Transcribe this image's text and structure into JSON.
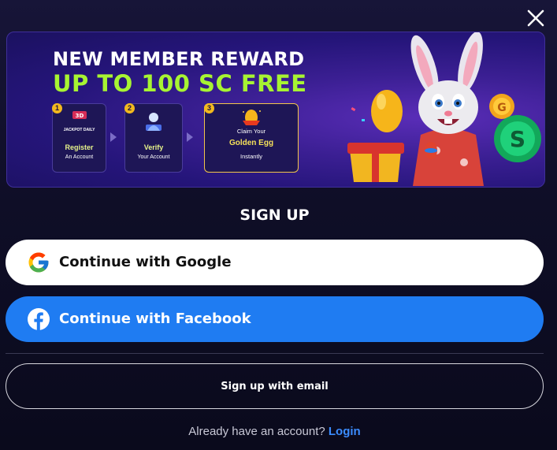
{
  "banner": {
    "title": "NEW MEMBER REWARD",
    "subtitle": "UP TO 100 SC FREE",
    "steps": [
      {
        "number": "1",
        "badge": "JACKPOT DAILY",
        "line1": "Register",
        "line2": "An Account"
      },
      {
        "number": "2",
        "line1": "Verify",
        "line2": "Your Account"
      },
      {
        "number": "3",
        "line0": "Claim Your",
        "line1": "Golden Egg",
        "line2": "Instantly"
      }
    ]
  },
  "signup": {
    "heading": "SIGN UP",
    "google_label": "Continue with Google",
    "facebook_label": "Continue with Facebook",
    "email_label": "Sign up with email"
  },
  "footer": {
    "prompt": "Already have an account?",
    "login_label": "Login"
  },
  "colors": {
    "accent_green": "#a7f432",
    "facebook_blue": "#1f7cf2",
    "login_link": "#3b8cff",
    "background": "#0f0e27"
  },
  "icons": [
    "close-icon",
    "google-icon",
    "facebook-icon",
    "bunny-mascot",
    "golden-egg-icon",
    "coin-icon"
  ]
}
